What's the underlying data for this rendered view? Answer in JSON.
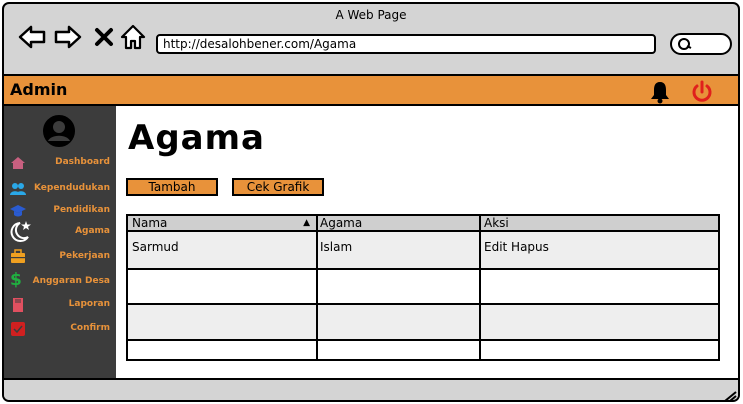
{
  "window": {
    "title": "A Web Page"
  },
  "browser": {
    "url": "http://desalohbener.com/Agama"
  },
  "topbar": {
    "brand": "Admin"
  },
  "sidebar": {
    "items": [
      {
        "label": "Dashboard",
        "icon": "home-icon",
        "color": "#c86080"
      },
      {
        "label": "Kependudukan",
        "icon": "users-icon",
        "color": "#2aa8e8"
      },
      {
        "label": "Pendidikan",
        "icon": "graduation-cap-icon",
        "color": "#2a5bd0"
      },
      {
        "label": "Agama",
        "icon": "moon-star-icon",
        "color": "#ffffff"
      },
      {
        "label": "Pekerjaan",
        "icon": "briefcase-icon",
        "color": "#f0a020"
      },
      {
        "label": "Anggaran Desa",
        "icon": "dollar-icon",
        "color": "#20b040"
      },
      {
        "label": "Laporan",
        "icon": "book-icon",
        "color": "#e05060"
      },
      {
        "label": "Confirm",
        "icon": "confirm-check-icon",
        "color": "#d02020"
      }
    ]
  },
  "main": {
    "title": "Agama",
    "buttons": {
      "add": "Tambah",
      "chart": "Cek Grafik"
    },
    "table": {
      "headers": [
        "Nama",
        "Agama",
        "Aksi"
      ],
      "rows": [
        [
          "Sarmud",
          "Islam",
          "Edit Hapus"
        ],
        [
          "",
          "",
          ""
        ],
        [
          "",
          "",
          ""
        ],
        [
          "",
          "",
          ""
        ]
      ]
    }
  },
  "colors": {
    "accent": "#e8923a",
    "sidebar": "#3c3c3c",
    "power": "#e0201c"
  }
}
